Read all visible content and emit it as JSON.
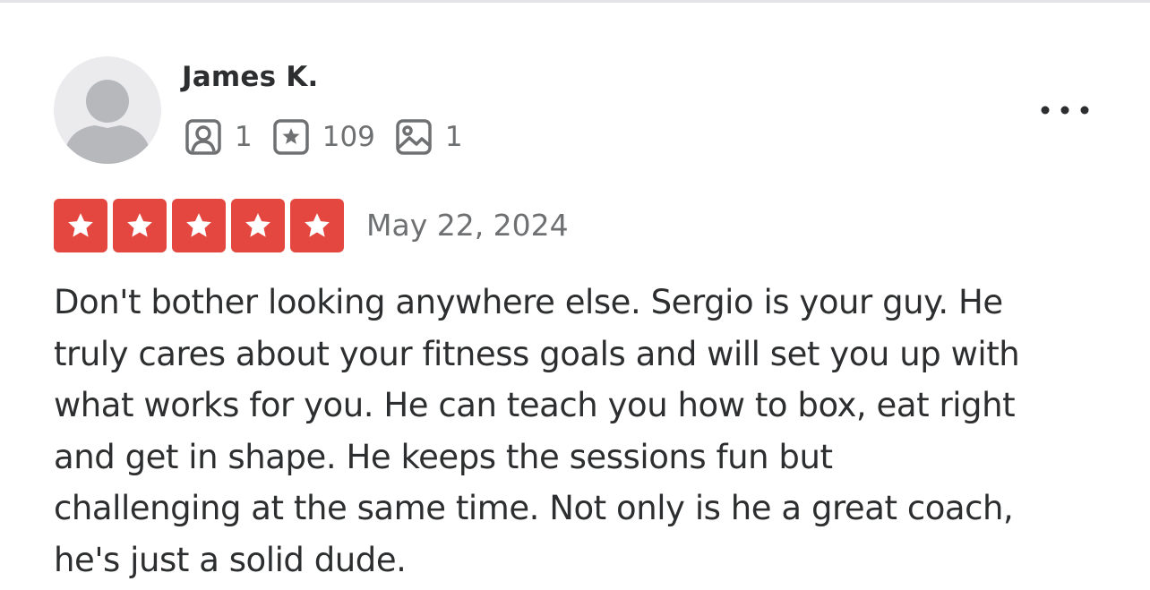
{
  "reviewer": {
    "name": "James K.",
    "avatar_icon": "default-user-avatar-icon",
    "stats": [
      {
        "icon": "friends-icon",
        "value": "1"
      },
      {
        "icon": "reviews-star-icon",
        "value": "109"
      },
      {
        "icon": "photos-icon",
        "value": "1"
      }
    ]
  },
  "menu": {
    "icon": "more-options-icon"
  },
  "rating": {
    "value": 5,
    "max": 5,
    "color": "#e4473f"
  },
  "review": {
    "date": "May 22, 2024",
    "text": "Don't bother looking anywhere else. Sergio is your guy.  He\ntruly cares about your fitness goals and will set you up with\nwhat works for you. He can teach you how to box, eat right\nand get in shape. He keeps the sessions fun but\nchallenging at the same time. Not only is he a great coach,\nhe's just a solid dude."
  }
}
